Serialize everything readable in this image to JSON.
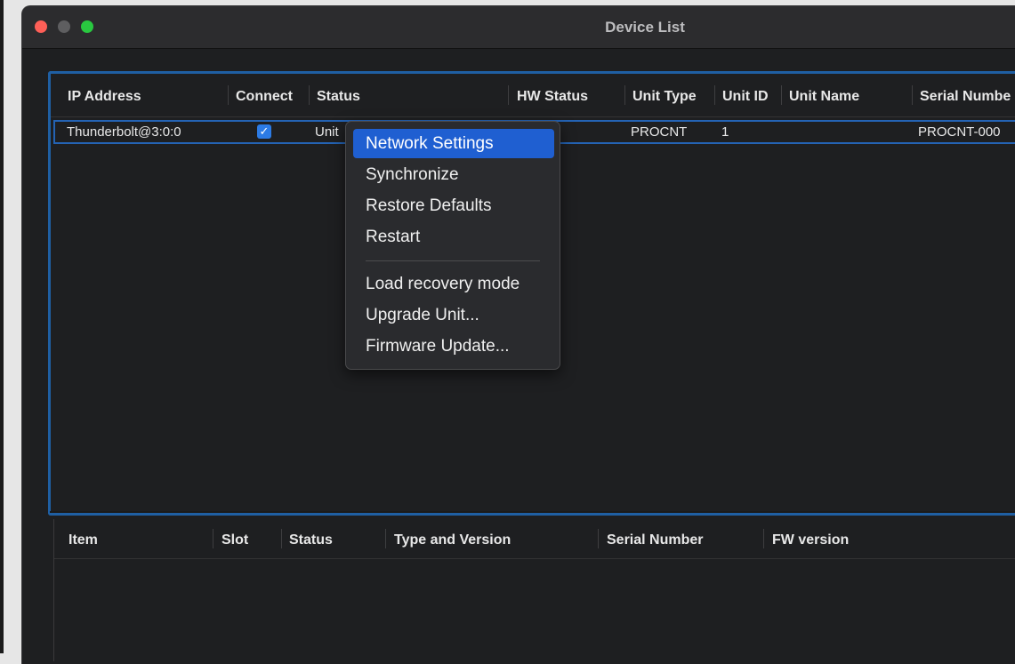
{
  "window": {
    "title": "Device List"
  },
  "device_table": {
    "columns": [
      "IP Address",
      "Connect",
      "Status",
      "HW Status",
      "Unit Type",
      "Unit ID",
      "Unit Name",
      "Serial Numbe"
    ],
    "rows": [
      {
        "ip_address": "Thunderbolt@3:0:0",
        "connect": true,
        "status": "Unit",
        "hw_status": "",
        "unit_type": "PROCNT",
        "unit_id": "1",
        "unit_name": "",
        "serial_number": "PROCNT-000"
      }
    ]
  },
  "context_menu": {
    "items": [
      {
        "label": "Network Settings",
        "selected": true
      },
      {
        "label": "Synchronize"
      },
      {
        "label": "Restore Defaults"
      },
      {
        "label": "Restart"
      },
      {
        "label": "Load recovery mode"
      },
      {
        "label": "Upgrade Unit..."
      },
      {
        "label": "Firmware Update..."
      }
    ]
  },
  "detail_table": {
    "columns": [
      "Item",
      "Slot",
      "Status",
      "Type and Version",
      "Serial Number",
      "FW version"
    ]
  },
  "colors": {
    "accent": "#1f5fd1",
    "frame_border": "#1f5fa3",
    "close": "#fe5f57",
    "minimize": "#5e5e60",
    "maximize": "#29c840"
  },
  "icons": {
    "checkbox": "checkmark-icon"
  }
}
